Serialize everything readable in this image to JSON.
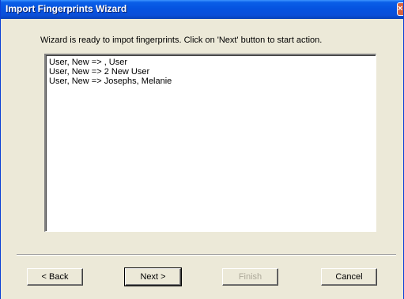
{
  "window": {
    "title": "Import Fingerprints Wizard",
    "close_label": "×"
  },
  "instruction": "Wizard is ready to impot fingerprints. Click  on 'Next' button to start action.",
  "list": {
    "items": [
      "User, New => , User",
      "User, New => 2 New User",
      "User, New => Josephs, Melanie"
    ]
  },
  "buttons": {
    "back": "< Back",
    "next": "Next >",
    "finish": "Finish",
    "cancel": "Cancel"
  },
  "states": {
    "finish_enabled": false
  },
  "colors": {
    "titlebar": "#0553e0",
    "dialog_bg": "#ece9d8",
    "disabled_text": "#aca899"
  }
}
